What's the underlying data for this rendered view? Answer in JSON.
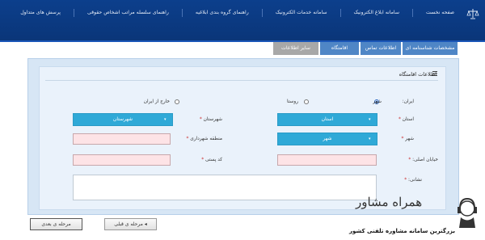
{
  "nav": {
    "items": [
      "صفحه نخست",
      "سامانه ابلاغ الکترونیک",
      "سامانه خدمات الکترونیک",
      "راهنمای گروه بندی ابلاغیه",
      "راهنمای سلسله مراتب اشخاص حقوقی",
      "پرسش های متداول"
    ]
  },
  "steps": [
    "مشخصات شناسنامه ای",
    "اطلاعات تماس",
    "اقامتگاه",
    "سایر اطلاعات"
  ],
  "section_title": "اطلاعات اقامتگاه",
  "form": {
    "location_label": "ایران:",
    "radio_options": [
      "شهر",
      "روستا",
      "خارج از ایران"
    ],
    "ostan_label": "استان",
    "ostan_value": "استان",
    "shahrestan_label": "شهرستان",
    "shahrestan_value": "شهرستان",
    "shahr_label": "شهر",
    "shahr_value": "شهر",
    "mantaghe_label": "منطقه شهرداری",
    "khiaban_label": "خیابان اصلی:",
    "codeposti_label": "کد پستی",
    "neshani_label": "نشانی:"
  },
  "buttons": {
    "prev": "مرحله ی قبلی",
    "next": "مرحله ی بعدی"
  },
  "watermark": {
    "title": "همراه مشاور",
    "subtitle": "بزرگترین سامانه مشاوره تلفنی کشور"
  }
}
